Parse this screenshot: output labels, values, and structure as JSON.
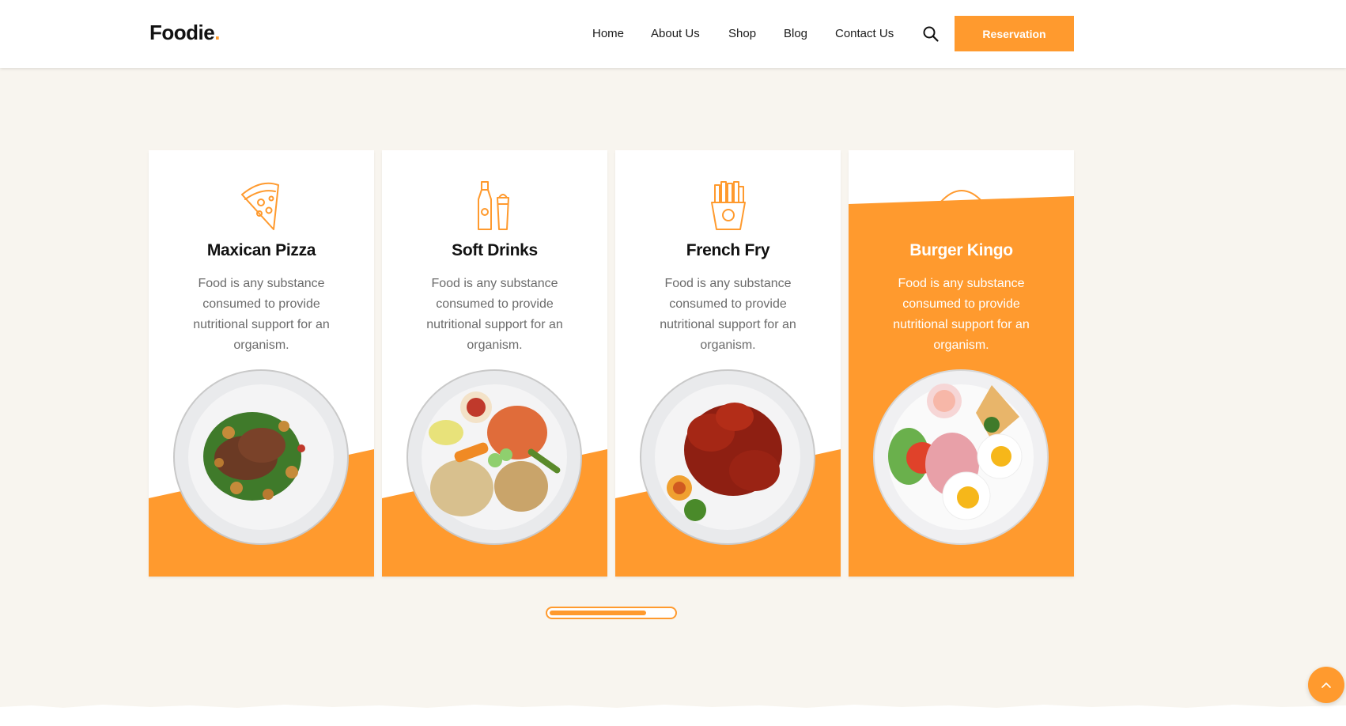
{
  "header": {
    "logo_text": "Foodie",
    "logo_dot": ".",
    "nav": [
      "Home",
      "About Us",
      "Shop",
      "Blog",
      "Contact Us"
    ],
    "search_icon": "search-icon",
    "reservation_label": "Reservation"
  },
  "cards": [
    {
      "title": "Maxican Pizza",
      "desc": "Food is any substance consumed to provide nutritional support for an organism.",
      "icon": "pizza-slice-icon",
      "active": false
    },
    {
      "title": "Soft Drinks",
      "desc": "Food is any substance consumed to provide nutritional support for an organism.",
      "icon": "drinks-bottle-icon",
      "active": false
    },
    {
      "title": "French Fry",
      "desc": "Food is any substance consumed to provide nutritional support for an organism.",
      "icon": "french-fries-icon",
      "active": false
    },
    {
      "title": "Burger Kingo",
      "desc": "Food is any substance consumed to provide nutritional support for an organism.",
      "icon": "burger-icon",
      "active": true
    }
  ],
  "slider": {
    "progress": 0.78
  },
  "back_to_top_icon": "chevron-up-icon",
  "colors": {
    "accent": "#ff9a2e",
    "background": "#f8f5ef",
    "text": "#111111",
    "muted": "#6b6b6b"
  }
}
